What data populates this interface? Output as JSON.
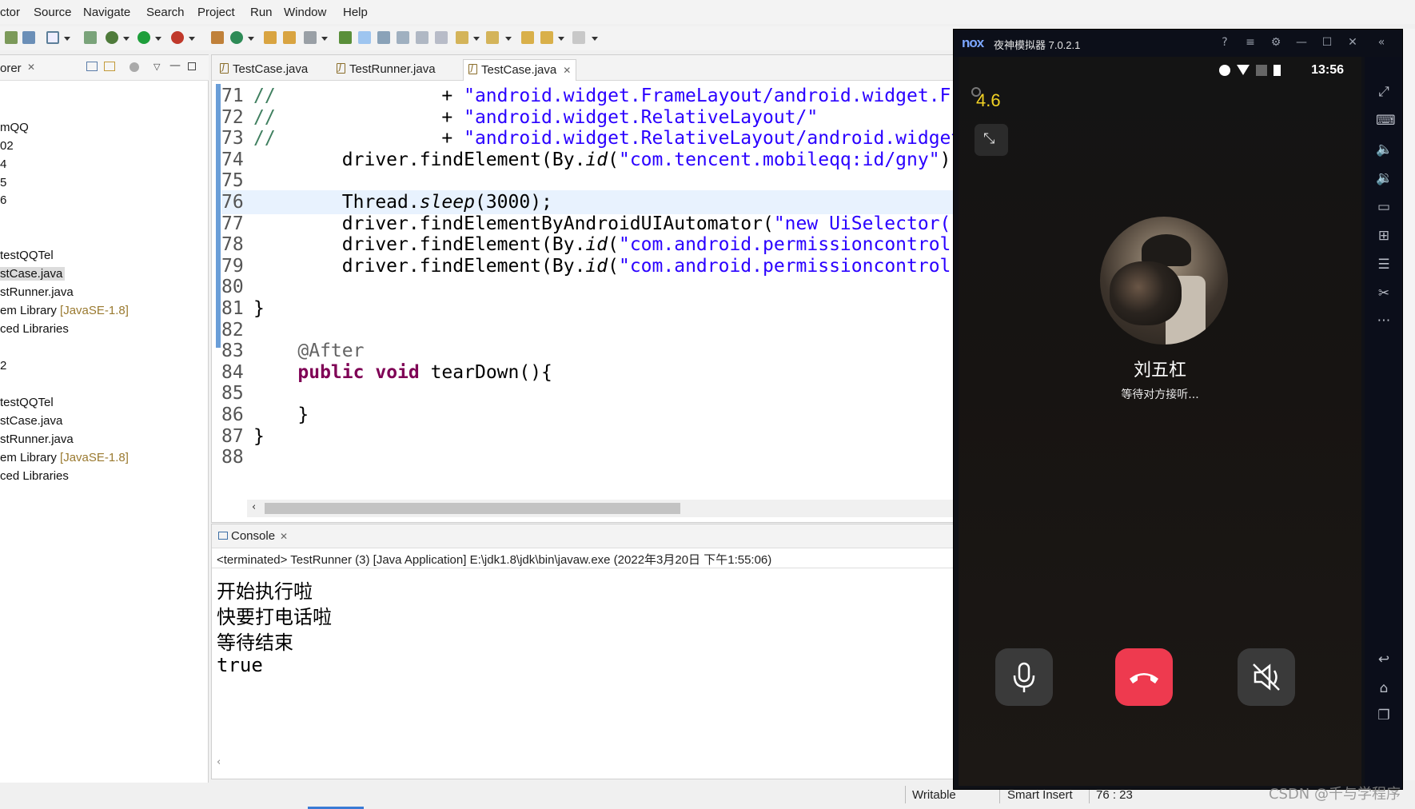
{
  "menu": [
    "ctor",
    "Source",
    "Navigate",
    "Search",
    "Project",
    "Run",
    "Window",
    "Help"
  ],
  "explorer": {
    "title": "orer",
    "items": [
      {
        "text": "mQQ",
        "deco": ""
      },
      {
        "text": "02",
        "deco": ""
      },
      {
        "text": "4",
        "deco": ""
      },
      {
        "text": "5",
        "deco": ""
      },
      {
        "text": "6",
        "deco": ""
      },
      {
        "text": "testQQTel",
        "deco": ""
      },
      {
        "text": "stCase.java",
        "deco": ""
      },
      {
        "text": "stRunner.java",
        "deco": ""
      },
      {
        "text": "em Library ",
        "deco": "[JavaSE-1.8]"
      },
      {
        "text": "ced Libraries",
        "deco": ""
      },
      {
        "text": "2",
        "deco": ""
      },
      {
        "text": "testQQTel",
        "deco": ""
      },
      {
        "text": "stCase.java",
        "deco": ""
      },
      {
        "text": "stRunner.java",
        "deco": ""
      },
      {
        "text": "em Library ",
        "deco": "[JavaSE-1.8]"
      },
      {
        "text": "ced Libraries",
        "deco": ""
      }
    ]
  },
  "editor": {
    "tabs": [
      "TestCase.java",
      "TestRunner.java",
      "TestCase.java"
    ],
    "lines": [
      {
        "n": "71",
        "parts": [
          [
            "cm",
            "//"
          ],
          [
            "",
            "               + "
          ],
          [
            "st",
            "\"android.widget.FrameLayout/android.widget.Fr"
          ]
        ]
      },
      {
        "n": "72",
        "parts": [
          [
            "cm",
            "//"
          ],
          [
            "",
            "               + "
          ],
          [
            "st",
            "\"android.widget.RelativeLayout/\""
          ]
        ]
      },
      {
        "n": "73",
        "parts": [
          [
            "cm",
            "//"
          ],
          [
            "",
            "               + "
          ],
          [
            "st",
            "\"android.widget.RelativeLayout/android.widget"
          ]
        ]
      },
      {
        "n": "74",
        "parts": [
          [
            "",
            "        driver.findElement(By."
          ],
          [
            "it",
            "id"
          ],
          [
            "",
            "("
          ],
          [
            "st",
            "\"com.tencent.mobileqq:id/gny\""
          ],
          [
            "",
            ")"
          ]
        ]
      },
      {
        "n": "75",
        "parts": []
      },
      {
        "n": "76",
        "parts": [
          [
            "",
            "        Thread."
          ],
          [
            "it",
            "sleep"
          ],
          [
            "",
            "(3000);"
          ]
        ]
      },
      {
        "n": "77",
        "parts": [
          [
            "",
            "        driver.findElementByAndroidUIAutomator("
          ],
          [
            "st",
            "\"new UiSelector("
          ]
        ]
      },
      {
        "n": "78",
        "parts": [
          [
            "",
            "        driver.findElement(By."
          ],
          [
            "it",
            "id"
          ],
          [
            "",
            "("
          ],
          [
            "st",
            "\"com.android.permissioncontrol"
          ]
        ]
      },
      {
        "n": "79",
        "parts": [
          [
            "",
            "        driver.findElement(By."
          ],
          [
            "it",
            "id"
          ],
          [
            "",
            "("
          ],
          [
            "st",
            "\"com.android.permissioncontrol"
          ]
        ]
      },
      {
        "n": "80",
        "parts": []
      },
      {
        "n": "81",
        "parts": [
          [
            "",
            "}"
          ]
        ]
      },
      {
        "n": "82",
        "parts": []
      },
      {
        "n": "83",
        "parts": [
          [
            "ann",
            "    @After"
          ]
        ]
      },
      {
        "n": "84",
        "parts": [
          [
            "kw",
            "    public"
          ],
          [
            "",
            " "
          ],
          [
            "kw",
            "void"
          ],
          [
            "",
            " tearDown(){"
          ]
        ]
      },
      {
        "n": "85",
        "parts": []
      },
      {
        "n": "86",
        "parts": [
          [
            "",
            "    }"
          ]
        ]
      },
      {
        "n": "87",
        "parts": [
          [
            "",
            "}"
          ]
        ]
      },
      {
        "n": "88",
        "parts": []
      }
    ]
  },
  "console": {
    "title": "Console",
    "terminated": "<terminated> TestRunner (3) [Java Application] E:\\jdk1.8\\jdk\\bin\\javaw.exe (2022年3月20日 下午1:55:06)",
    "output": [
      "开始执行啦",
      "快要打电话啦",
      "等待结束",
      "true"
    ]
  },
  "status": {
    "writable": "Writable",
    "insert": "Smart Insert",
    "position": "76 : 23"
  },
  "nox": {
    "logo": "nox",
    "title": "夜神模拟器 7.0.2.1",
    "time": "13:56",
    "fps": "4.6",
    "caller_name": "刘五杠",
    "caller_status": "等待对方接听..."
  },
  "watermark": "CSDN @千与学程序"
}
